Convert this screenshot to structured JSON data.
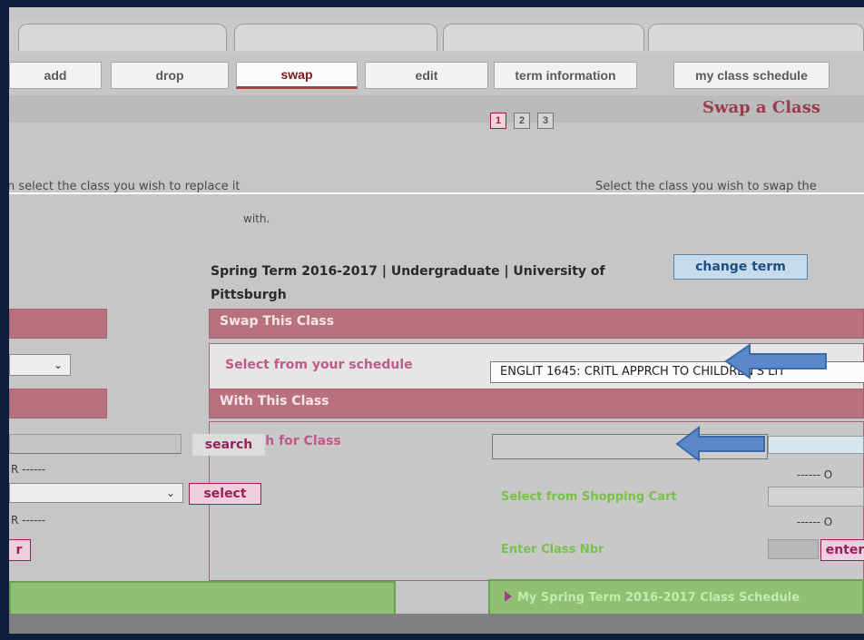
{
  "tabs": [
    {
      "label": "add"
    },
    {
      "label": "drop"
    },
    {
      "label": "swap"
    },
    {
      "label": "edit"
    },
    {
      "label": "term information"
    },
    {
      "label": "my class schedule"
    }
  ],
  "page_title": "Swap a Class",
  "steps": [
    "1",
    "2",
    "3"
  ],
  "instructions": {
    "left": "n select the class you wish to replace it",
    "right": "Select the class you wish to swap the",
    "sub": "with."
  },
  "term": {
    "text": "Spring Term 2016-2017 | Undergraduate | University of Pittsburgh",
    "change_button": "change term"
  },
  "swap_section": {
    "header": "Swap This Class",
    "label": "Select from your schedule",
    "selected": "ENGLIT 1645: CRITL APPRCH TO CHILDREN'S LIT"
  },
  "with_section": {
    "header": "With This Class",
    "search_label": "Search for Class",
    "search_button": "search",
    "select_button": "select",
    "enter_button": "enter",
    "cart_label": "Select from Shopping Cart",
    "class_nbr_label": "Enter Class Nbr",
    "or_left1": "R ------",
    "or_left2": "R ------",
    "or_right": "------ O",
    "left_button_partial": "r"
  },
  "schedule_panel": {
    "title": "My Spring Term 2016-2017 Class Schedule"
  },
  "colors": {
    "band": "#b7727e",
    "accent_pink": "#9c1d5a",
    "green": "#8fc074",
    "arrow": "#5b88c8"
  }
}
